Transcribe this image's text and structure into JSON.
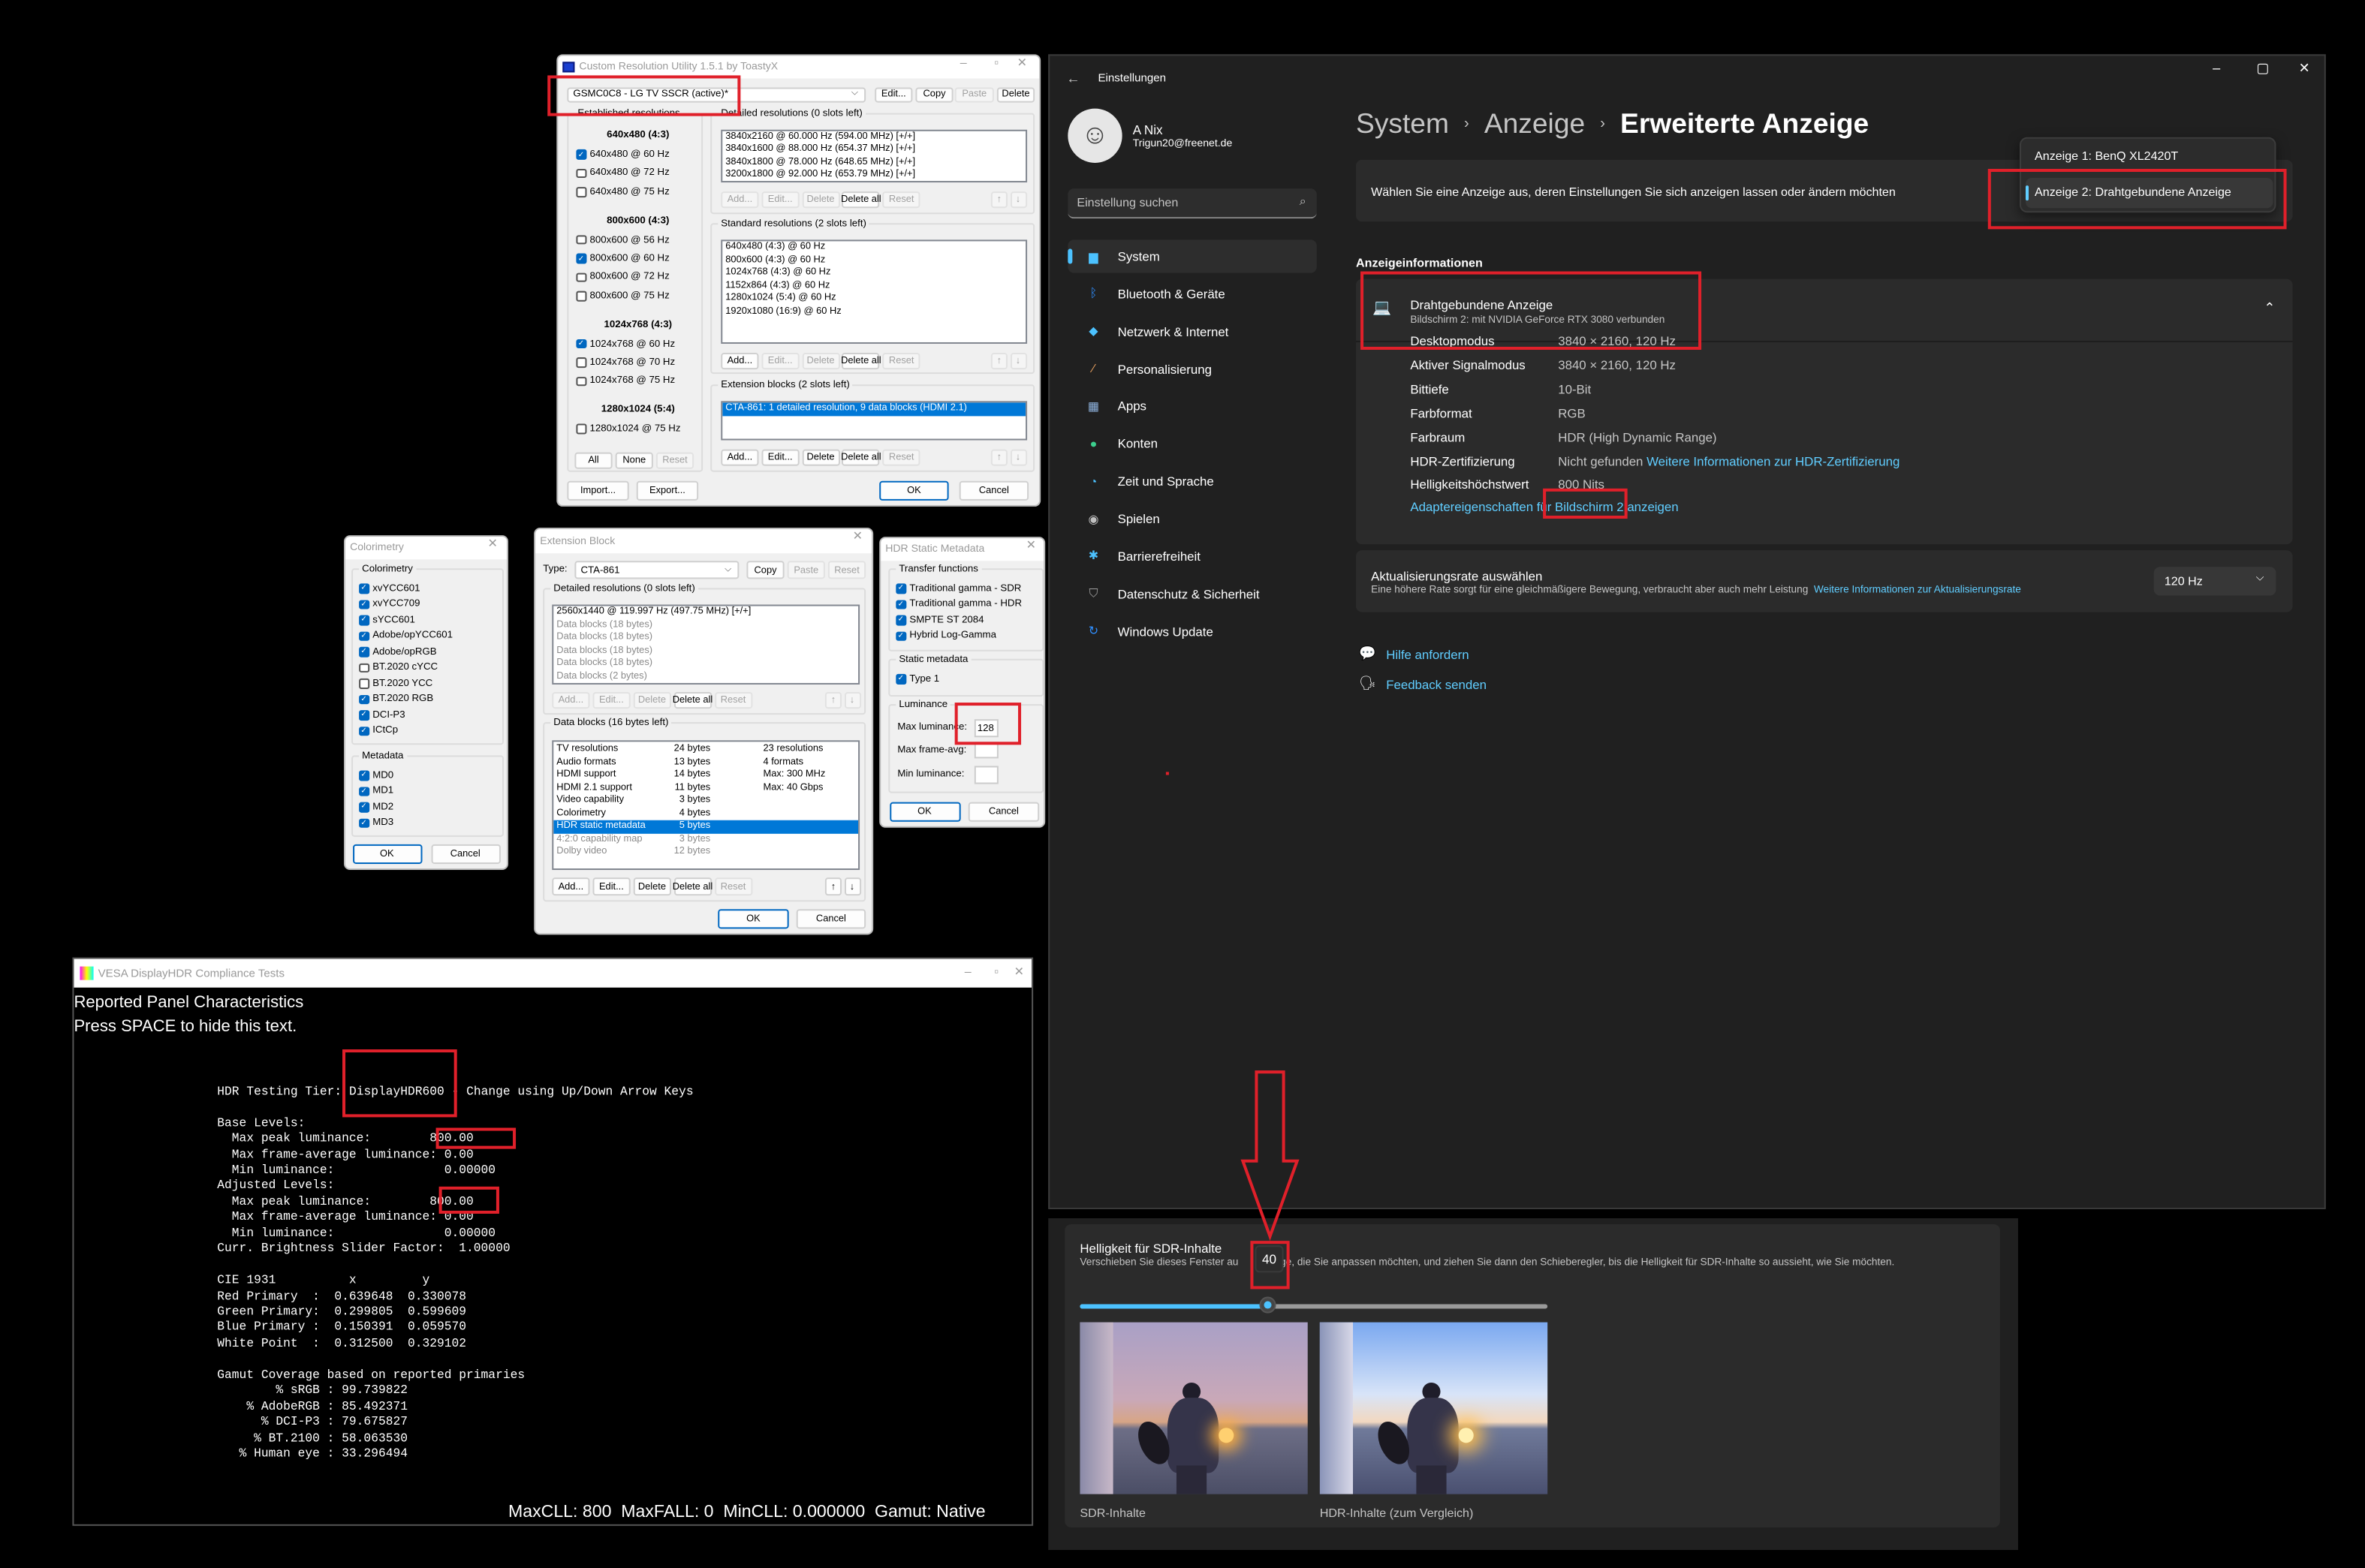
{
  "cru": {
    "title": "Custom Resolution Utility 1.5.1 by ToastyX",
    "display_select": "GSMC0C8 - LG TV SSCR (active)*",
    "top_buttons": [
      {
        "label": "Edit...",
        "enabled": true
      },
      {
        "label": "Copy",
        "enabled": true
      },
      {
        "label": "Paste",
        "enabled": false
      },
      {
        "label": "Delete",
        "enabled": true
      }
    ],
    "established": {
      "label": "Established resolutions",
      "groups": [
        {
          "heading": "640x480 (4:3)",
          "items": [
            {
              "label": "640x480 @ 60 Hz",
              "checked": true
            },
            {
              "label": "640x480 @ 72 Hz",
              "checked": false
            },
            {
              "label": "640x480 @ 75 Hz",
              "checked": false
            }
          ]
        },
        {
          "heading": "800x600 (4:3)",
          "items": [
            {
              "label": "800x600 @ 56 Hz",
              "checked": false
            },
            {
              "label": "800x600 @ 60 Hz",
              "checked": true
            },
            {
              "label": "800x600 @ 72 Hz",
              "checked": false
            },
            {
              "label": "800x600 @ 75 Hz",
              "checked": false
            }
          ]
        },
        {
          "heading": "1024x768 (4:3)",
          "items": [
            {
              "label": "1024x768 @ 60 Hz",
              "checked": true
            },
            {
              "label": "1024x768 @ 70 Hz",
              "checked": false
            },
            {
              "label": "1024x768 @ 75 Hz",
              "checked": false
            }
          ]
        },
        {
          "heading": "1280x1024 (5:4)",
          "items": [
            {
              "label": "1280x1024 @ 75 Hz",
              "checked": false
            }
          ]
        }
      ],
      "buttons": [
        {
          "label": "All",
          "enabled": true
        },
        {
          "label": "None",
          "enabled": true
        },
        {
          "label": "Reset",
          "enabled": false
        }
      ]
    },
    "detailed": {
      "label": "Detailed resolutions (0 slots left)",
      "items": [
        "3840x2160 @ 60.000 Hz (594.00 MHz) [+/+]",
        "3840x1600 @ 88.000 Hz (654.37 MHz) [+/+]",
        "3840x1800 @ 78.000 Hz (648.65 MHz) [+/+]",
        "3200x1800 @ 92.000 Hz (653.79 MHz) [+/+]"
      ],
      "buttons": [
        {
          "label": "Add...",
          "enabled": false
        },
        {
          "label": "Edit...",
          "enabled": false
        },
        {
          "label": "Delete",
          "enabled": false
        },
        {
          "label": "Delete all",
          "enabled": true
        },
        {
          "label": "Reset",
          "enabled": false
        }
      ],
      "arrows": [
        {
          "label": "↑",
          "enabled": false
        },
        {
          "label": "↓",
          "enabled": false
        }
      ]
    },
    "standard": {
      "label": "Standard resolutions (2 slots left)",
      "items": [
        "640x480 (4:3) @ 60 Hz",
        "800x600 (4:3) @ 60 Hz",
        "1024x768 (4:3) @ 60 Hz",
        "1152x864 (4:3) @ 60 Hz",
        "1280x1024 (5:4) @ 60 Hz",
        "1920x1080 (16:9) @ 60 Hz"
      ],
      "buttons": [
        {
          "label": "Add...",
          "enabled": true
        },
        {
          "label": "Edit...",
          "enabled": false
        },
        {
          "label": "Delete",
          "enabled": false
        },
        {
          "label": "Delete all",
          "enabled": true
        },
        {
          "label": "Reset",
          "enabled": false
        }
      ],
      "arrows": [
        {
          "label": "↑",
          "enabled": false
        },
        {
          "label": "↓",
          "enabled": false
        }
      ]
    },
    "extension": {
      "label": "Extension blocks (2 slots left)",
      "items": [
        "CTA-861: 1 detailed resolution, 9 data blocks (HDMI 2.1)"
      ],
      "selected": 0,
      "buttons": [
        {
          "label": "Add...",
          "enabled": true
        },
        {
          "label": "Edit...",
          "enabled": true
        },
        {
          "label": "Delete",
          "enabled": true
        },
        {
          "label": "Delete all",
          "enabled": true
        },
        {
          "label": "Reset",
          "enabled": false
        }
      ],
      "arrows": [
        {
          "label": "↑",
          "enabled": false
        },
        {
          "label": "↓",
          "enabled": false
        }
      ]
    },
    "import_label": "Import...",
    "export_label": "Export...",
    "ok_label": "OK",
    "cancel_label": "Cancel"
  },
  "colorimetry": {
    "title": "Colorimetry",
    "group_label": "Colorimetry",
    "items": [
      {
        "label": "xvYCC601",
        "checked": true
      },
      {
        "label": "xvYCC709",
        "checked": true
      },
      {
        "label": "sYCC601",
        "checked": true
      },
      {
        "label": "Adobe/opYCC601",
        "checked": true
      },
      {
        "label": "Adobe/opRGB",
        "checked": true
      },
      {
        "label": "BT.2020 cYCC",
        "checked": false
      },
      {
        "label": "BT.2020 YCC",
        "checked": false
      },
      {
        "label": "BT.2020 RGB",
        "checked": true
      },
      {
        "label": "DCI-P3",
        "checked": true
      },
      {
        "label": "ICtCp",
        "checked": true
      }
    ],
    "metadata_label": "Metadata",
    "metadata": [
      {
        "label": "MD0",
        "checked": true
      },
      {
        "label": "MD1",
        "checked": true
      },
      {
        "label": "MD2",
        "checked": true
      },
      {
        "label": "MD3",
        "checked": true
      }
    ],
    "ok_label": "OK",
    "cancel_label": "Cancel"
  },
  "extension_block": {
    "title": "Extension Block",
    "type_label": "Type:",
    "type_value": "CTA-861",
    "top_buttons": [
      {
        "label": "Copy",
        "enabled": true
      },
      {
        "label": "Paste",
        "enabled": false
      },
      {
        "label": "Reset",
        "enabled": false
      }
    ],
    "detailed": {
      "label": "Detailed resolutions (0 slots left)",
      "items": [
        {
          "text": "2560x1440 @ 119.997 Hz (497.75 MHz) [+/+]",
          "gray": false
        },
        {
          "text": "Data blocks (18 bytes)",
          "gray": true
        },
        {
          "text": "Data blocks (18 bytes)",
          "gray": true
        },
        {
          "text": "Data blocks (18 bytes)",
          "gray": true
        },
        {
          "text": "Data blocks (18 bytes)",
          "gray": true
        },
        {
          "text": "Data blocks (2 bytes)",
          "gray": true
        }
      ],
      "buttons": [
        {
          "label": "Add...",
          "enabled": false
        },
        {
          "label": "Edit...",
          "enabled": false
        },
        {
          "label": "Delete",
          "enabled": false
        },
        {
          "label": "Delete all",
          "enabled": true
        },
        {
          "label": "Reset",
          "enabled": false
        }
      ],
      "arrows": [
        {
          "label": "↑",
          "enabled": false
        },
        {
          "label": "↓",
          "enabled": false
        }
      ]
    },
    "data_blocks": {
      "label": "Data blocks (16 bytes left)",
      "rows": [
        {
          "name": "TV resolutions",
          "size": "24 bytes",
          "info": "23 resolutions",
          "gray": false,
          "selected": false
        },
        {
          "name": "Audio formats",
          "size": "13 bytes",
          "info": "4 formats",
          "gray": false,
          "selected": false
        },
        {
          "name": "HDMI support",
          "size": "14 bytes",
          "info": "Max: 300 MHz",
          "gray": false,
          "selected": false
        },
        {
          "name": "HDMI 2.1 support",
          "size": "11 bytes",
          "info": "Max: 40 Gbps",
          "gray": false,
          "selected": false
        },
        {
          "name": "Video capability",
          "size": "3 bytes",
          "info": "",
          "gray": false,
          "selected": false
        },
        {
          "name": "Colorimetry",
          "size": "4 bytes",
          "info": "",
          "gray": false,
          "selected": false
        },
        {
          "name": "HDR static metadata",
          "size": "5 bytes",
          "info": "",
          "gray": false,
          "selected": true
        },
        {
          "name": "4:2:0 capability map",
          "size": "3 bytes",
          "info": "",
          "gray": true,
          "selected": false
        },
        {
          "name": "Dolby video",
          "size": "12 bytes",
          "info": "",
          "gray": true,
          "selected": false
        }
      ],
      "buttons": [
        {
          "label": "Add...",
          "enabled": true
        },
        {
          "label": "Edit...",
          "enabled": true
        },
        {
          "label": "Delete",
          "enabled": true
        },
        {
          "label": "Delete all",
          "enabled": true
        },
        {
          "label": "Reset",
          "enabled": false
        }
      ],
      "arrows": [
        {
          "label": "↑",
          "enabled": true
        },
        {
          "label": "↓",
          "enabled": true
        }
      ]
    },
    "ok_label": "OK",
    "cancel_label": "Cancel"
  },
  "hdr_static": {
    "title": "HDR Static Metadata",
    "transfer_label": "Transfer functions",
    "transfer": [
      {
        "label": "Traditional gamma - SDR",
        "checked": true
      },
      {
        "label": "Traditional gamma - HDR",
        "checked": true
      },
      {
        "label": "SMPTE ST 2084",
        "checked": true
      },
      {
        "label": "Hybrid Log-Gamma",
        "checked": true
      }
    ],
    "static_label": "Static metadata",
    "static": [
      {
        "label": "Type 1",
        "checked": true
      }
    ],
    "luminance_label": "Luminance",
    "max_lum_label": "Max luminance:",
    "max_lum_value": "128",
    "max_avg_label": "Max frame-avg:",
    "max_avg_value": "",
    "min_lum_label": "Min luminance:",
    "min_lum_value": "",
    "ok_label": "OK",
    "cancel_label": "Cancel"
  },
  "vesa": {
    "title": "VESA DisplayHDR Compliance Tests",
    "heading": "Reported Panel Characteristics",
    "hint": "Press SPACE to hide this text.",
    "tier_prefix": "HDR Testing Tier: ",
    "tier_value": "DisplayHDR600",
    "tier_suffix": " - Change using Up/Down Arrow Keys",
    "lines": [
      "Base Levels:",
      "  Max peak luminance:        800.00",
      "  Max frame-average luminance: 0.00",
      "  Min luminance:               0.00000",
      "Adjusted Levels:",
      "  Max peak luminance:        800.00",
      "  Max frame-average luminance: 0.00",
      "  Min luminance:               0.00000",
      "Curr. Brightness Slider Factor:  1.00000",
      "",
      "CIE 1931          x         y",
      "Red Primary  :  0.639648  0.330078",
      "Green Primary:  0.299805  0.599609",
      "Blue Primary :  0.150391  0.059570",
      "White Point  :  0.312500  0.329102",
      "",
      "Gamut Coverage based on reported primaries",
      "        % sRGB : 99.739822",
      "    % AdobeRGB : 85.492371",
      "      % DCI-P3 : 79.675827",
      "     % BT.2100 : 58.063530",
      "   % Human eye : 33.296494"
    ],
    "footer": "MaxCLL: 800  MaxFALL: 0  MinCLL: 0.000000  Gamut: Native"
  },
  "settings": {
    "app_title": "Einstellungen",
    "user": {
      "name": "A Nix",
      "email": "Trigun20@freenet.de"
    },
    "search_placeholder": "Einstellung suchen",
    "nav": [
      {
        "label": "System",
        "icon": "monitor-icon",
        "color": "#4cc2ff",
        "active": true
      },
      {
        "label": "Bluetooth & Geräte",
        "icon": "bluetooth-icon",
        "color": "#2f8fff"
      },
      {
        "label": "Netzwerk & Internet",
        "icon": "wifi-icon",
        "color": "#4cc2ff"
      },
      {
        "label": "Personalisierung",
        "icon": "brush-icon",
        "color": "#e8a060"
      },
      {
        "label": "Apps",
        "icon": "apps-icon",
        "color": "#8fb4e0"
      },
      {
        "label": "Konten",
        "icon": "person-icon",
        "color": "#3ccf8e"
      },
      {
        "label": "Zeit und Sprache",
        "icon": "clock-globe-icon",
        "color": "#4cc2ff"
      },
      {
        "label": "Spielen",
        "icon": "gamepad-icon",
        "color": "#c0c0c0"
      },
      {
        "label": "Barrierefreiheit",
        "icon": "accessibility-icon",
        "color": "#4cc2ff"
      },
      {
        "label": "Datenschutz & Sicherheit",
        "icon": "shield-icon",
        "color": "#a0a0a0"
      },
      {
        "label": "Windows Update",
        "icon": "update-icon",
        "color": "#2f8fff"
      }
    ],
    "breadcrumb": [
      "System",
      "Anzeige",
      "Erweiterte Anzeige"
    ],
    "select_display_text": "Wählen Sie eine Anzeige aus, deren Einstellungen Sie sich anzeigen lassen oder ändern möchten",
    "display_options": [
      "Anzeige 1: BenQ XL2420T",
      "Anzeige 2: Drahtgebundene Anzeige"
    ],
    "selected_display": 1,
    "section_title": "Anzeigeinformationen",
    "display_name": "Drahtgebundene Anzeige",
    "display_sub": "Bildschirm 2: mit NVIDIA GeForce RTX 3080 verbunden",
    "info": [
      {
        "label": "Desktopmodus",
        "value": "3840 × 2160, 120 Hz"
      },
      {
        "label": "Aktiver Signalmodus",
        "value": "3840 × 2160, 120 Hz"
      },
      {
        "label": "Bittiefe",
        "value": "10-Bit"
      },
      {
        "label": "Farbformat",
        "value": "RGB"
      },
      {
        "label": "Farbraum",
        "value": "HDR (High Dynamic Range)"
      },
      {
        "label": "HDR-Zertifizierung",
        "value": "Nicht gefunden",
        "link": "Weitere Informationen zur HDR-Zertifizierung"
      },
      {
        "label": "Helligkeitshöchstwert",
        "value": "800 Nits"
      }
    ],
    "adapter_link": "Adaptereigenschaften für Bildschirm 2 anzeigen",
    "refresh_title": "Aktualisierungsrate auswählen",
    "refresh_sub": "Eine höhere Rate sorgt für eine gleichmäßigere Bewegung, verbraucht aber auch mehr Leistung",
    "refresh_link": "Weitere Informationen zur Aktualisierungsrate",
    "refresh_value": "120 Hz",
    "help_link": "Hilfe anfordern",
    "feedback_link": "Feedback senden",
    "accent": "#60cdff"
  },
  "sdr": {
    "title": "Helligkeit für SDR-Inhalte",
    "desc_before": "Verschieben Sie dieses Fenster au",
    "desc_after": "zeige, die Sie anpassen möchten, und ziehen Sie dann den Schieberegler, bis die Helligkeit für SDR-Inhalte so aussieht, wie Sie möchten.",
    "slider_value": 40,
    "slider_max": 100,
    "tooltip": "40",
    "sdr_label": "SDR-Inhalte",
    "hdr_label": "HDR-Inhalte (zum Vergleich)"
  },
  "highlight_color": "#e0202a"
}
